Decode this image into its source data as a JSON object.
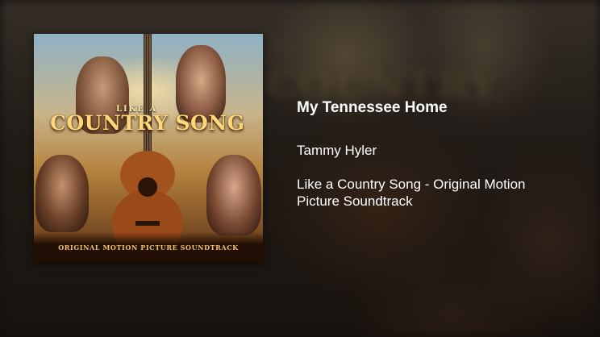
{
  "track": {
    "title": "My Tennessee Home",
    "artist": "Tammy Hyler",
    "album": "Like a Country Song - Original Motion Picture Soundtrack"
  },
  "album_art": {
    "title_small": "LIKE A",
    "title_big": "COUNTRY SONG",
    "subtitle": "ORIGINAL MOTION PICTURE SOUNDTRACK"
  },
  "colors": {
    "text": "#ffffff",
    "art_title": "#ffd67a",
    "art_subtitle": "#f1c36b"
  }
}
